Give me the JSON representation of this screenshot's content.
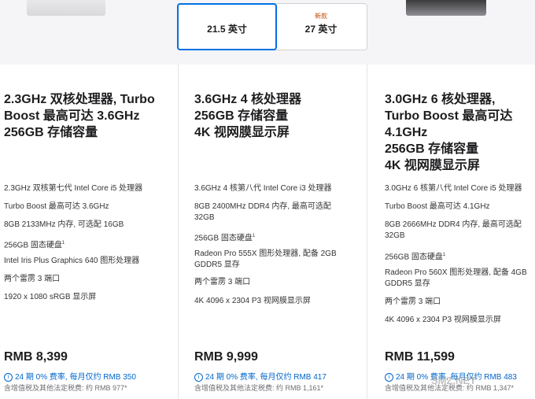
{
  "size_tabs": [
    {
      "label": "21.5 英寸",
      "badge": ""
    },
    {
      "label": "27 英寸",
      "badge": "新款"
    }
  ],
  "columns": [
    {
      "title_lines": [
        "2.3GHz 双核处理器, Turbo",
        "Boost 最高可达 3.6GHz",
        "256GB 存储容量"
      ],
      "specs": [
        "2.3GHz 双核第七代 Intel Core i5 处理器",
        "Turbo Boost 最高可达 3.6GHz",
        "8GB 2133MHz 内存, 可选配 16GB",
        "256GB 固态硬盘",
        "Intel Iris Plus Graphics 640 图形处理器",
        "两个雷雳 3 端口",
        "1920 x 1080 sRGB 显示屏"
      ],
      "footnote_mark": "1",
      "price": "RMB 8,399",
      "installment": "24 期 0% 费率, 每月仅约 RMB 350",
      "tax": "含增值税及其他法定税费: 约 RMB 977*"
    },
    {
      "title_lines": [
        "3.6GHz 4 核处理器",
        "256GB 存储容量",
        "4K 视网膜显示屏"
      ],
      "specs": [
        "3.6GHz 4 核第八代 Intel Core i3 处理器",
        "8GB 2400MHz DDR4 内存, 最高可选配",
        "32GB",
        "256GB 固态硬盘",
        "Radeon Pro 555X 图形处理器, 配备 2GB",
        "GDDR5 显存",
        "两个雷雳 3 端口",
        "4K 4096 x 2304 P3 视网膜显示屏"
      ],
      "footnote_mark": "1",
      "price": "RMB 9,999",
      "installment": "24 期 0% 费率, 每月仅约 RMB 417",
      "tax": "含增值税及其他法定税费: 约 RMB 1,161*"
    },
    {
      "title_lines": [
        "3.0GHz 6 核处理器,",
        "Turbo Boost 最高可达",
        "4.1GHz",
        "256GB 存储容量",
        "4K 视网膜显示屏"
      ],
      "specs": [
        "3.0GHz 6 核第八代 Intel Core i5 处理器",
        "Turbo Boost 最高可达 4.1GHz",
        "8GB 2666MHz DDR4 内存, 最高可选配",
        "32GB",
        "256GB 固态硬盘",
        "Radeon Pro 560X 图形处理器, 配备 4GB",
        "GDDR5 显存",
        "两个雷雳 3 端口",
        "4K 4096 x 2304 P3 视网膜显示屏"
      ],
      "footnote_mark": "1",
      "price": "RMB 11,599",
      "installment": "24 期 0% 费率, 每月仅约 RMB 483",
      "tax": "含增值税及其他法定税费: 约 RMB 1,347*"
    }
  ],
  "watermark": "SMZ.NET",
  "info_icon": "info-circle-icon",
  "colors": {
    "accent": "#0071e3",
    "link": "#0066cc",
    "badge": "#bf4800"
  }
}
